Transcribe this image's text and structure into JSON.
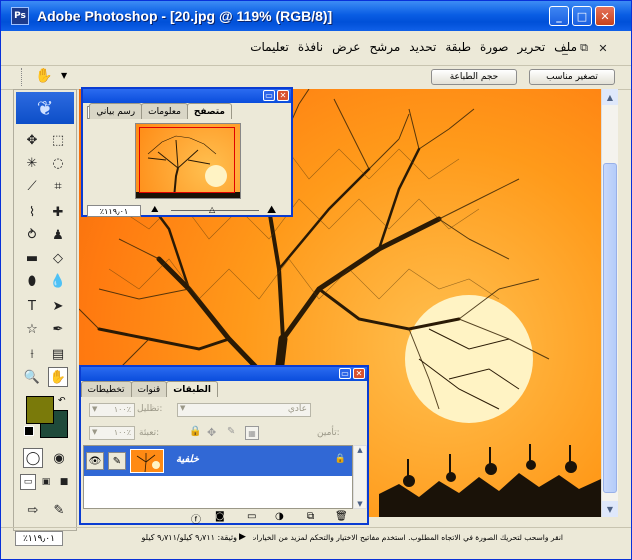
{
  "window": {
    "title": "Adobe Photoshop - [20.jpg @ 119% (RGB/8)]",
    "app_icon": "Ps",
    "buttons": {
      "minimize": "_",
      "maximize": "□",
      "close": "✕"
    }
  },
  "menu": {
    "items": [
      "ملف",
      "تحرير",
      "صورة",
      "طبقة",
      "تحديد",
      "مرشح",
      "عرض",
      "نافذة",
      "تعليمات"
    ],
    "doc_controls": {
      "close": "✕",
      "restore": "⧉",
      "minimize": "_"
    }
  },
  "options_bar": {
    "tool_icon": "hand-icon",
    "fit_button": "تصغير مناسب",
    "print_size_button": "حجم الطباعة"
  },
  "navigator": {
    "tabs": [
      "متصفح",
      "معلومات",
      "رسم بياني"
    ],
    "zoom_value": "٪١١٩٫٠١"
  },
  "layers": {
    "tabs": [
      "الطبقات",
      "قنوات",
      "تخطيطات"
    ],
    "blend_mode": "عادي",
    "opacity_label": "تظليل:",
    "opacity_value": "١٠٠٪",
    "lock_label": "تأمين:",
    "fill_label": "تعبئة:",
    "fill_value": "١٠٠٪",
    "layer_name": "خلفية"
  },
  "status": {
    "zoom": "٪١١٩٫٠١",
    "doc_size": "وثيقة: ٩٫٧١١ كيلو/٩٫٧١١ كيلو",
    "hint": "انقر واسحب لتحريك الصورة في الاتجاه المطلوب. استخدم مفاتيح الاختيار والتحكم لمزيد من الخيارات."
  },
  "colors": {
    "titlebar": "#0a5ee4",
    "foreground": "#7a7a0a",
    "background": "#1f4a3a",
    "sky": "#ff9a1a",
    "moon": "#fff3c4"
  }
}
